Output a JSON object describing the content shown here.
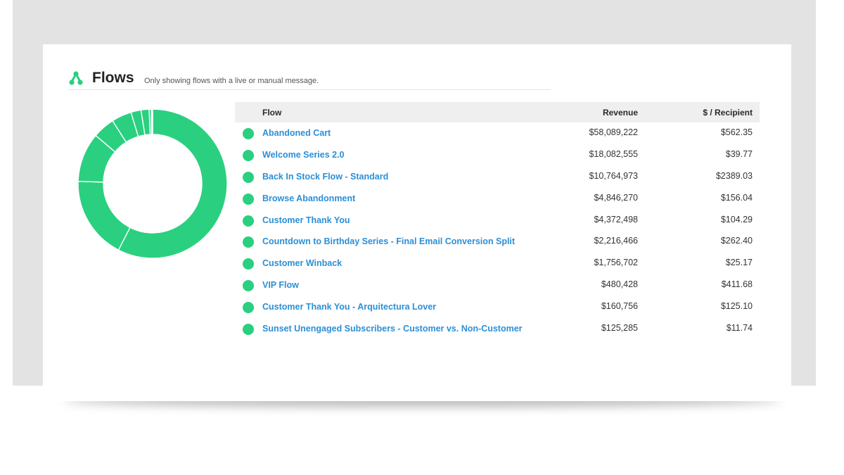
{
  "header": {
    "title": "Flows",
    "subtitle": "Only showing flows with a live or manual message."
  },
  "colors": {
    "accent": "#2ad07f",
    "link": "#2b8fd6",
    "header_bg": "#efefef"
  },
  "table": {
    "columns": [
      "Flow",
      "Revenue",
      "$ / Recipient"
    ],
    "rows": [
      {
        "flow": "Abandoned Cart",
        "revenue": "$58,089,222",
        "per_recipient": "$562.35"
      },
      {
        "flow": "Welcome Series 2.0",
        "revenue": "$18,082,555",
        "per_recipient": "$39.77"
      },
      {
        "flow": "Back In Stock Flow - Standard",
        "revenue": "$10,764,973",
        "per_recipient": "$2389.03"
      },
      {
        "flow": "Browse Abandonment",
        "revenue": "$4,846,270",
        "per_recipient": "$156.04"
      },
      {
        "flow": "Customer Thank You",
        "revenue": "$4,372,498",
        "per_recipient": "$104.29"
      },
      {
        "flow": "Countdown to Birthday Series - Final Email Conversion Split",
        "revenue": "$2,216,466",
        "per_recipient": "$262.40"
      },
      {
        "flow": "Customer Winback",
        "revenue": "$1,756,702",
        "per_recipient": "$25.17"
      },
      {
        "flow": "VIP Flow",
        "revenue": "$480,428",
        "per_recipient": "$411.68"
      },
      {
        "flow": "Customer Thank You - Arquitectura Lover",
        "revenue": "$160,756",
        "per_recipient": "$125.10"
      },
      {
        "flow": "Sunset Unengaged Subscribers - Customer vs. Non-Customer",
        "revenue": "$125,285",
        "per_recipient": "$11.74"
      }
    ]
  },
  "chart_data": {
    "type": "pie",
    "categories": [
      "Abandoned Cart",
      "Welcome Series 2.0",
      "Back In Stock Flow - Standard",
      "Browse Abandonment",
      "Customer Thank You",
      "Countdown to Birthday Series - Final Email Conversion Split",
      "Customer Winback",
      "VIP Flow",
      "Customer Thank You - Arquitectura Lover",
      "Sunset Unengaged Subscribers - Customer vs. Non-Customer"
    ],
    "values": [
      58089222,
      18082555,
      10764973,
      4846270,
      4372498,
      2216466,
      1756702,
      480428,
      160756,
      125285
    ],
    "color": "#2ad07f"
  }
}
